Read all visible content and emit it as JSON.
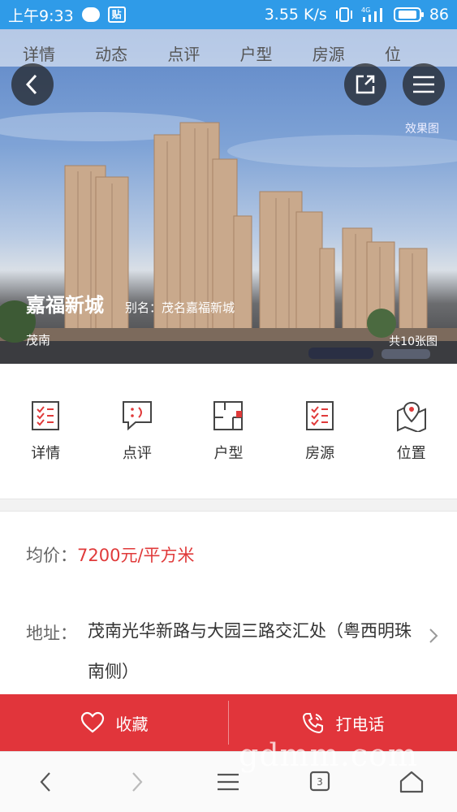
{
  "status_bar": {
    "time": "上午9:33",
    "tieba_label": "贴",
    "network_speed": "3.55 K/s",
    "signal": "4G",
    "battery_level": "86"
  },
  "hero": {
    "tabs": [
      "详情",
      "动态",
      "点评",
      "户型",
      "房源",
      "位"
    ],
    "effect_label": "效果图",
    "project_name": "嘉福新城",
    "alias": "别名：茂名嘉福新城",
    "district": "茂南",
    "photo_count": "共10张图"
  },
  "features": [
    {
      "label": "详情",
      "icon": "list-doc-icon"
    },
    {
      "label": "点评",
      "icon": "comment-icon"
    },
    {
      "label": "户型",
      "icon": "floorplan-icon"
    },
    {
      "label": "房源",
      "icon": "list-doc-icon"
    },
    {
      "label": "位置",
      "icon": "map-pin-icon"
    }
  ],
  "info": {
    "price_label": "均价：",
    "price_value": "7200元/平方米",
    "address_label": "地址：",
    "address_value": "茂南光华新路与大园三路交汇处（粤西明珠南侧）"
  },
  "actions": {
    "favorite": "收藏",
    "call": "打电话"
  },
  "browser_nav": {
    "tab_count": "3"
  },
  "watermark": "gdmm.com",
  "colors": {
    "status_bar": "#2f9be8",
    "accent_red": "#e1353b",
    "price_red": "#e03a3a"
  }
}
